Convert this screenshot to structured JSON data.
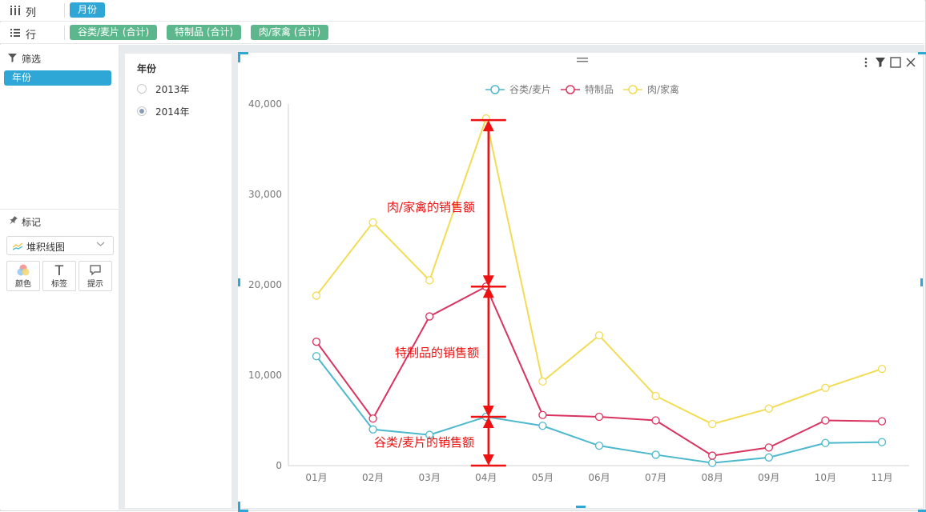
{
  "shelves": {
    "columns": {
      "label": "列",
      "icon": "columns-icon",
      "pills": [
        "月份"
      ]
    },
    "rows": {
      "label": "行",
      "icon": "rows-icon",
      "pills": [
        "谷类/麦片 (合计)",
        "特制品 (合计)",
        "肉/家禽 (合计)"
      ]
    }
  },
  "left_panel": {
    "filter_header": "筛选",
    "filter_pill": "年份",
    "marks_header": "标记",
    "chart_type": "堆积线图",
    "mark_buttons": [
      {
        "label": "颜色",
        "icon": "color-icon"
      },
      {
        "label": "标签",
        "icon": "text-icon"
      },
      {
        "label": "提示",
        "icon": "tooltip-icon"
      }
    ]
  },
  "year_filter": {
    "title": "年份",
    "options": [
      {
        "label": "2013年",
        "selected": false
      },
      {
        "label": "2014年",
        "selected": true
      }
    ]
  },
  "colors": {
    "accent": "#2ea7d6",
    "pill_green": "#5cb88c",
    "series": [
      "#4cb8cc",
      "#d9335f",
      "#f2dc55"
    ],
    "annotation": "#ee1111"
  },
  "chart_data": {
    "type": "line",
    "stacked": true,
    "categories": [
      "01月",
      "02月",
      "03月",
      "04月",
      "05月",
      "06月",
      "07月",
      "08月",
      "09月",
      "10月",
      "11月"
    ],
    "series": [
      {
        "name": "谷类/麦片",
        "values": [
          12100,
          4000,
          3400,
          5400,
          4400,
          2200,
          1200,
          300,
          900,
          2500,
          2600
        ]
      },
      {
        "name": "特制品",
        "values": [
          13700,
          5200,
          16500,
          19800,
          5600,
          5400,
          5000,
          1100,
          2000,
          5000,
          4900
        ]
      },
      {
        "name": "肉/家禽",
        "values": [
          18800,
          26900,
          20500,
          38400,
          9300,
          14400,
          7700,
          4600,
          6300,
          8600,
          10700
        ]
      }
    ],
    "ylim": [
      0,
      40000
    ],
    "yticks": [
      "0",
      "10,000",
      "20,000",
      "30,000",
      "40,000"
    ],
    "ytick_values": [
      0,
      10000,
      20000,
      30000,
      40000
    ],
    "legend_position": "top-center",
    "grid": false,
    "annotations": [
      "肉/家禽的销售额",
      "特制品的销售额",
      "谷类/麦片的销售额"
    ]
  }
}
